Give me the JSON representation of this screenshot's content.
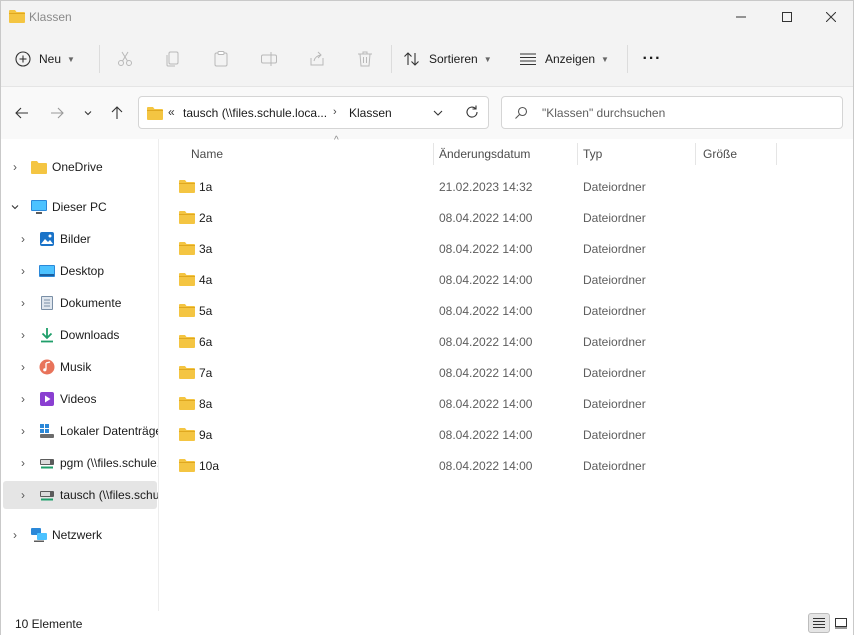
{
  "window": {
    "title": "Klassen"
  },
  "toolbar": {
    "new_label": "Neu",
    "sort_label": "Sortieren",
    "view_label": "Anzeigen",
    "more_label": "···"
  },
  "address": {
    "overflow_chevron": "«",
    "segments": [
      "tausch (\\\\files.schule.loca...",
      "Klassen"
    ],
    "separator": "›"
  },
  "search": {
    "placeholder": "\"Klassen\" durchsuchen"
  },
  "sidebar": {
    "items": [
      {
        "label": "OneDrive",
        "icon": "onedrive-folder-icon"
      },
      {
        "label": "Dieser PC",
        "icon": "pc-monitor-icon"
      },
      {
        "label": "Bilder",
        "icon": "pictures-icon"
      },
      {
        "label": "Desktop",
        "icon": "desktop-icon"
      },
      {
        "label": "Dokumente",
        "icon": "documents-icon"
      },
      {
        "label": "Downloads",
        "icon": "download-arrow-icon"
      },
      {
        "label": "Musik",
        "icon": "music-icon"
      },
      {
        "label": "Videos",
        "icon": "video-icon"
      },
      {
        "label": "Lokaler Datenträger (C:)",
        "icon": "local-drive-icon"
      },
      {
        "label": "pgm (\\\\files.schule.local)",
        "icon": "network-drive-icon"
      },
      {
        "label": "tausch (\\\\files.schule.local)",
        "icon": "network-drive-icon"
      },
      {
        "label": "Netzwerk",
        "icon": "network-icon"
      }
    ]
  },
  "columns": {
    "name": "Name",
    "date": "Änderungsdatum",
    "type": "Typ",
    "size": "Größe"
  },
  "files": [
    {
      "name": "1a",
      "date": "21.02.2023 14:32",
      "type": "Dateiordner"
    },
    {
      "name": "2a",
      "date": "08.04.2022 14:00",
      "type": "Dateiordner"
    },
    {
      "name": "3a",
      "date": "08.04.2022 14:00",
      "type": "Dateiordner"
    },
    {
      "name": "4a",
      "date": "08.04.2022 14:00",
      "type": "Dateiordner"
    },
    {
      "name": "5a",
      "date": "08.04.2022 14:00",
      "type": "Dateiordner"
    },
    {
      "name": "6a",
      "date": "08.04.2022 14:00",
      "type": "Dateiordner"
    },
    {
      "name": "7a",
      "date": "08.04.2022 14:00",
      "type": "Dateiordner"
    },
    {
      "name": "8a",
      "date": "08.04.2022 14:00",
      "type": "Dateiordner"
    },
    {
      "name": "9a",
      "date": "08.04.2022 14:00",
      "type": "Dateiordner"
    },
    {
      "name": "10a",
      "date": "08.04.2022 14:00",
      "type": "Dateiordner"
    }
  ],
  "status": {
    "count_text": "10 Elemente"
  },
  "colors": {
    "folder": "#f4c542",
    "folder_dark": "#e0a820",
    "selected_bg": "#e5e5e5",
    "accent": "#0067c0"
  }
}
